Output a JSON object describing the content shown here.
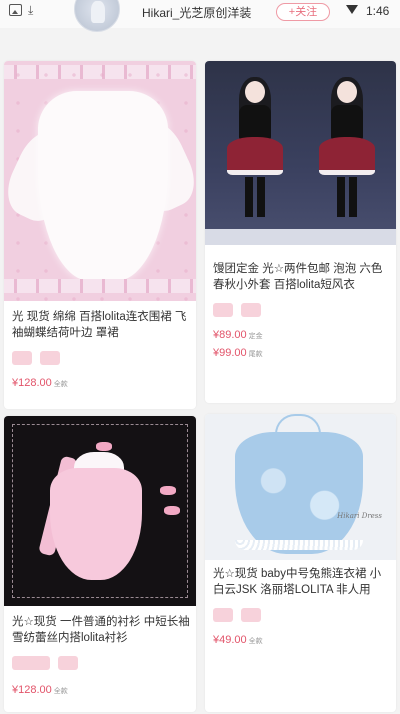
{
  "header": {
    "shop_name": "Hikari_光芝原创洋装",
    "follow_label": "+关注",
    "time": "1:46"
  },
  "products": [
    {
      "title": "光 现货 绵绵 百搭lolita连衣围裙 飞袖蝴蝶结荷叶边 罩裙",
      "prices": [
        {
          "value": "¥128.00",
          "unit": "全款"
        }
      ]
    },
    {
      "title": "馒团定金 光☆两件包邮 泡泡 六色 春秋小外套 百搭lolita短风衣",
      "prices": [
        {
          "value": "¥89.00",
          "unit": "定金"
        },
        {
          "value": "¥99.00",
          "unit": "尾款"
        }
      ]
    },
    {
      "title": "光☆现货 一件普通的衬衫 中短长袖 雪纺蕾丝内搭lolita衬衫",
      "prices": [
        {
          "value": "¥128.00",
          "unit": "全款"
        }
      ]
    },
    {
      "title": "光☆现货 baby中号兔熊连衣裙 小白云JSK 洛丽塔LOLITA 非人用",
      "prices": [
        {
          "value": "¥49.00",
          "unit": "全款"
        }
      ]
    }
  ],
  "photo_signatures": [
    "Hikari Dress"
  ],
  "colors": {
    "accent_pink": "#e2546a",
    "tag_pink": "#f7d2db",
    "follow_border": "#ef9aa5"
  },
  "icons": [
    "image-icon",
    "download-icon",
    "wifi-icon"
  ]
}
